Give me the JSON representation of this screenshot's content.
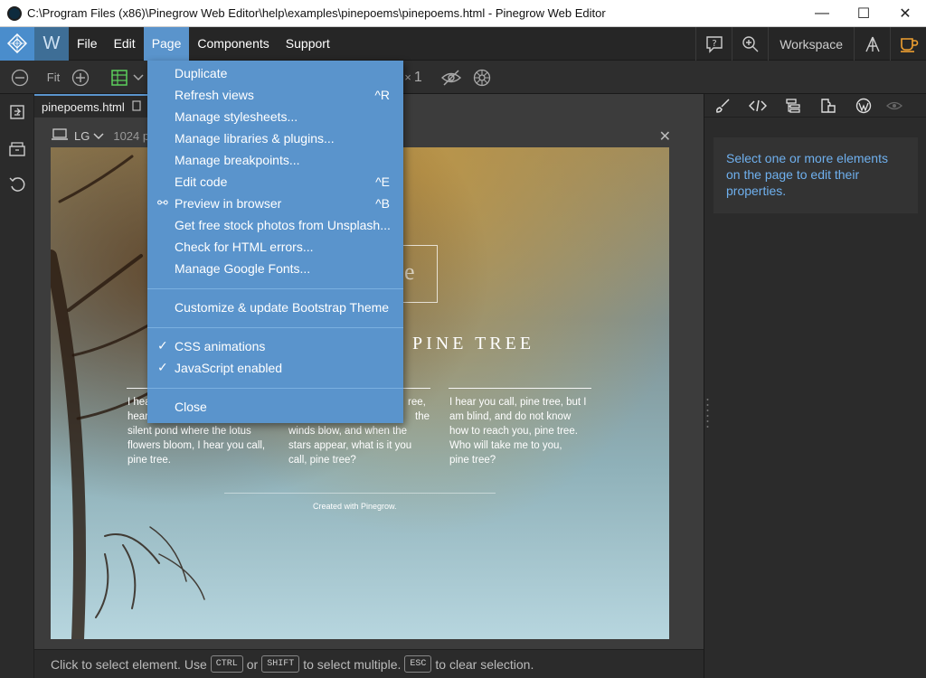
{
  "window": {
    "title": "C:\\Program Files (x86)\\Pinegrow Web Editor\\help\\examples\\pinepoems\\pinepoems.html - Pinegrow Web Editor",
    "minimize": "—",
    "maximize": "☐",
    "close": "✕"
  },
  "menubar": {
    "items": [
      "File",
      "Edit",
      "Page",
      "Components",
      "Support"
    ],
    "active": "Page",
    "workspace_label": "Workspace",
    "w_logo": "W"
  },
  "toolbar": {
    "fit_label": "Fit",
    "count": "1"
  },
  "editor": {
    "tab_label": "pinepoems.html",
    "device_label": "LG",
    "width_label": "1024 p",
    "close": "✕"
  },
  "preview": {
    "hero_letter": "e",
    "title": "PINE TREE",
    "col1": [
      "I hea",
      "hear",
      "silent pond where the lotus",
      "flowers bloom, I hear you call,",
      "pine tree."
    ],
    "col2": [
      "ree,",
      "the",
      "winds blow, and when the",
      "stars appear, what is it you",
      "call, pine tree?"
    ],
    "col3": [
      "I hear you call, pine tree, but I",
      "am blind, and do not know",
      "how to reach you, pine tree.",
      "Who will take me to you,",
      "pine tree?"
    ],
    "footer": "Created with Pinegrow."
  },
  "page_menu": {
    "items": [
      {
        "label": "Duplicate",
        "shortcut": ""
      },
      {
        "label": "Refresh views",
        "shortcut": "^R"
      },
      {
        "label": "Manage stylesheets...",
        "shortcut": ""
      },
      {
        "label": "Manage libraries & plugins...",
        "shortcut": ""
      },
      {
        "label": "Manage breakpoints...",
        "shortcut": ""
      },
      {
        "label": "Edit code",
        "shortcut": "^E"
      },
      {
        "label": "Preview in browser",
        "shortcut": "^B"
      },
      {
        "label": "Get free stock photos from Unsplash...",
        "shortcut": ""
      },
      {
        "label": "Check for HTML errors...",
        "shortcut": ""
      },
      {
        "label": "Manage Google Fonts...",
        "shortcut": ""
      },
      {
        "label": "Customize & update Bootstrap Theme",
        "shortcut": ""
      },
      {
        "label": "CSS animations",
        "checked": true
      },
      {
        "label": "JavaScript enabled",
        "checked": true
      },
      {
        "label": "Close",
        "shortcut": ""
      }
    ],
    "check_glyph": "✓",
    "link_glyph": "⚯"
  },
  "right_panel": {
    "message": "Select one or more elements on the page to edit their properties."
  },
  "statusbar": {
    "text1": "Click to select element. Use",
    "key1": "CTRL",
    "or": "or",
    "key2": "SHIFT",
    "text2": "to select multiple.",
    "key3": "ESC",
    "text3": "to clear selection."
  },
  "colors": {
    "accent": "#5a94cc",
    "panel_bg": "#2b2b2b",
    "highlight_text": "#6fb0ee"
  }
}
